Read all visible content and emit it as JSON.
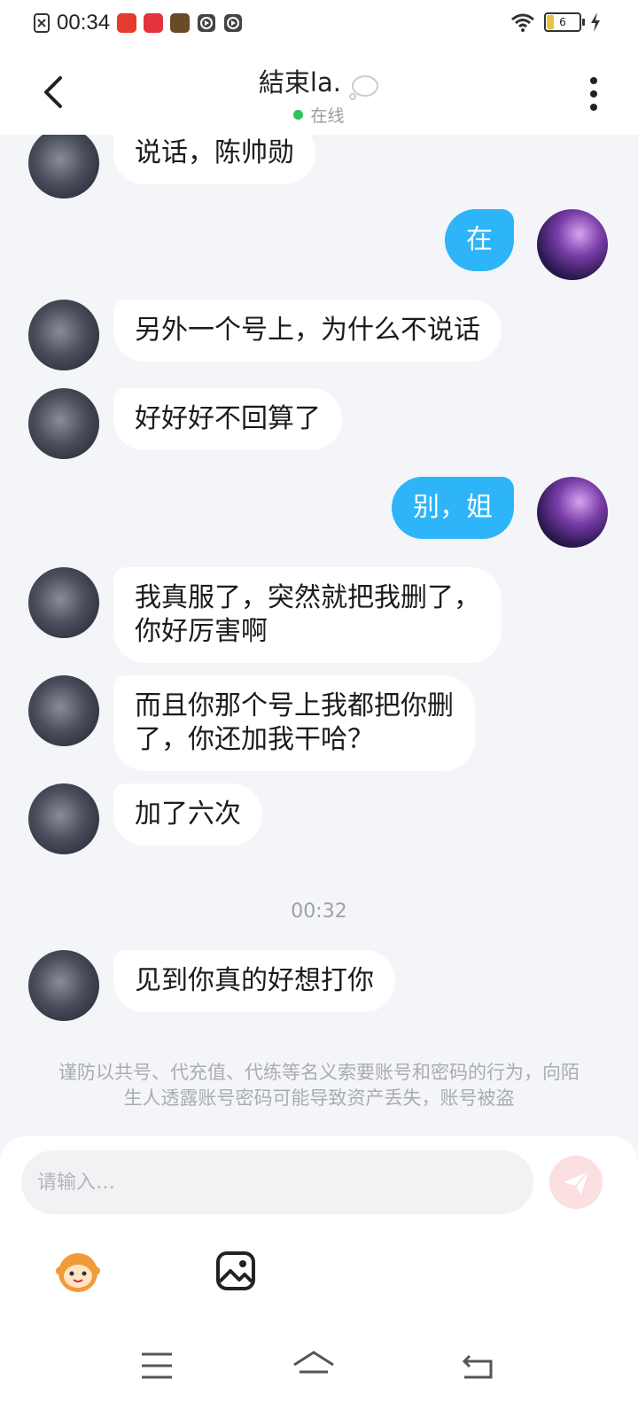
{
  "status_bar": {
    "time": "00:34",
    "battery_level": "6"
  },
  "header": {
    "title": "結束la.",
    "presence": "在线"
  },
  "messages": [
    {
      "side": "left",
      "text": "说话，陈帅勋"
    },
    {
      "side": "right",
      "text": "在"
    },
    {
      "side": "left",
      "text": "另外一个号上，为什么不说话"
    },
    {
      "side": "left",
      "text": "好好好不回算了"
    },
    {
      "side": "right",
      "text": "别，姐"
    },
    {
      "side": "left",
      "text": "我真服了，突然就把我删了，\n你好厉害啊"
    },
    {
      "side": "left",
      "text": "而且你那个号上我都把你删\n了，你还加我干哈？"
    },
    {
      "side": "left",
      "text": "加了六次"
    },
    {
      "side": "left",
      "text": "见到你真的好想打你"
    }
  ],
  "timestamp": "00:32",
  "notice": "谨防以共号、代充值、代练等名义索要账号和密码的行为，向陌生人透露账号密码可能导致资产丢失，账号被盗",
  "composer": {
    "placeholder": "请输入…"
  },
  "colors": {
    "accent": "#2eb4f8",
    "online": "#2ec25a",
    "send_inactive": "#fbdfe1"
  }
}
